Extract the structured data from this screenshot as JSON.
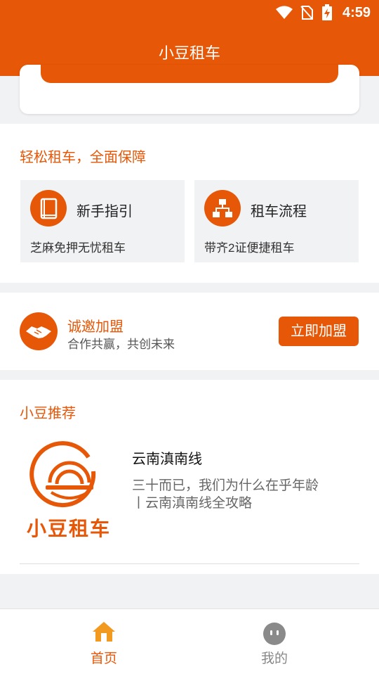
{
  "status_bar": {
    "time": "4:59"
  },
  "header": {
    "title": "小豆租车"
  },
  "guarantee": {
    "title": "轻松租车，全面保障",
    "features": [
      {
        "title": "新手指引",
        "desc": "芝麻免押无忧租车",
        "icon": "book-icon"
      },
      {
        "title": "租车流程",
        "desc": "带齐2证便捷租车",
        "icon": "flowchart-icon"
      }
    ]
  },
  "join": {
    "title": "诚邀加盟",
    "subtitle": "合作共赢，共创未来",
    "button": "立即加盟",
    "icon": "handshake-icon"
  },
  "recommend": {
    "title": "小豆推荐",
    "logo_text": "小豆租车",
    "article": {
      "title": "云南滇南线",
      "desc": "三十而已，我们为什么在乎年龄丨云南滇南线全攻略"
    }
  },
  "tabbar": {
    "tabs": [
      {
        "label": "首页",
        "active": true,
        "icon": "home-icon"
      },
      {
        "label": "我的",
        "active": false,
        "icon": "profile-face-icon"
      }
    ]
  },
  "colors": {
    "accent": "#e65707",
    "background": "#f1f2f4",
    "tab_inactive": "#888888"
  }
}
